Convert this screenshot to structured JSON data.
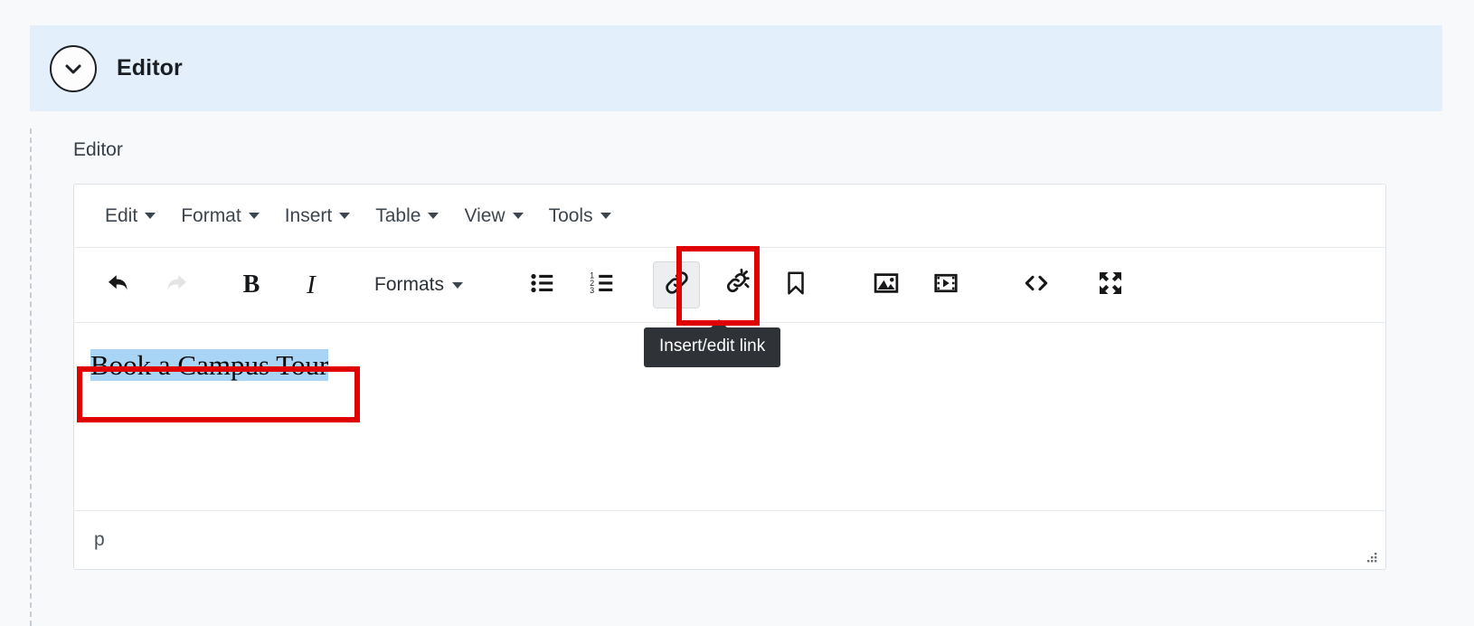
{
  "panel": {
    "title": "Editor",
    "toggle_icon": "chevron-down-icon"
  },
  "field": {
    "label": "Editor"
  },
  "editor": {
    "menubar": [
      {
        "label": "Edit",
        "name": "menu-edit"
      },
      {
        "label": "Format",
        "name": "menu-format"
      },
      {
        "label": "Insert",
        "name": "menu-insert"
      },
      {
        "label": "Table",
        "name": "menu-table"
      },
      {
        "label": "View",
        "name": "menu-view"
      },
      {
        "label": "Tools",
        "name": "menu-tools"
      }
    ],
    "toolbar": {
      "undo": "undo-icon",
      "redo": "redo-icon",
      "bold": "B",
      "italic": "I",
      "formats_label": "Formats",
      "bullist": "bullet-list-icon",
      "numlist": "numbered-list-icon",
      "link": "link-icon",
      "unlink": "unlink-icon",
      "anchor": "bookmark-icon",
      "image": "image-icon",
      "media": "media-icon",
      "code": "source-code-icon",
      "fullscreen": "fullscreen-icon"
    },
    "content": {
      "paragraph_text": "Book a Campus Tour",
      "selection_highlight_color": "#a8d4f5"
    },
    "statusbar": {
      "element_path": "p"
    }
  },
  "tooltip": {
    "text": "Insert/edit link"
  },
  "annotations": {
    "color": "#e00000",
    "boxes": [
      {
        "name": "anno-link-button",
        "target": "link-toolbar-button"
      },
      {
        "name": "anno-selected-text",
        "target": "selected-paragraph-text"
      }
    ]
  },
  "colors": {
    "panel_header_bg": "#e3effa",
    "page_bg": "#f8f9fa",
    "annotation_red": "#e00000",
    "tooltip_bg": "#2f3337"
  }
}
